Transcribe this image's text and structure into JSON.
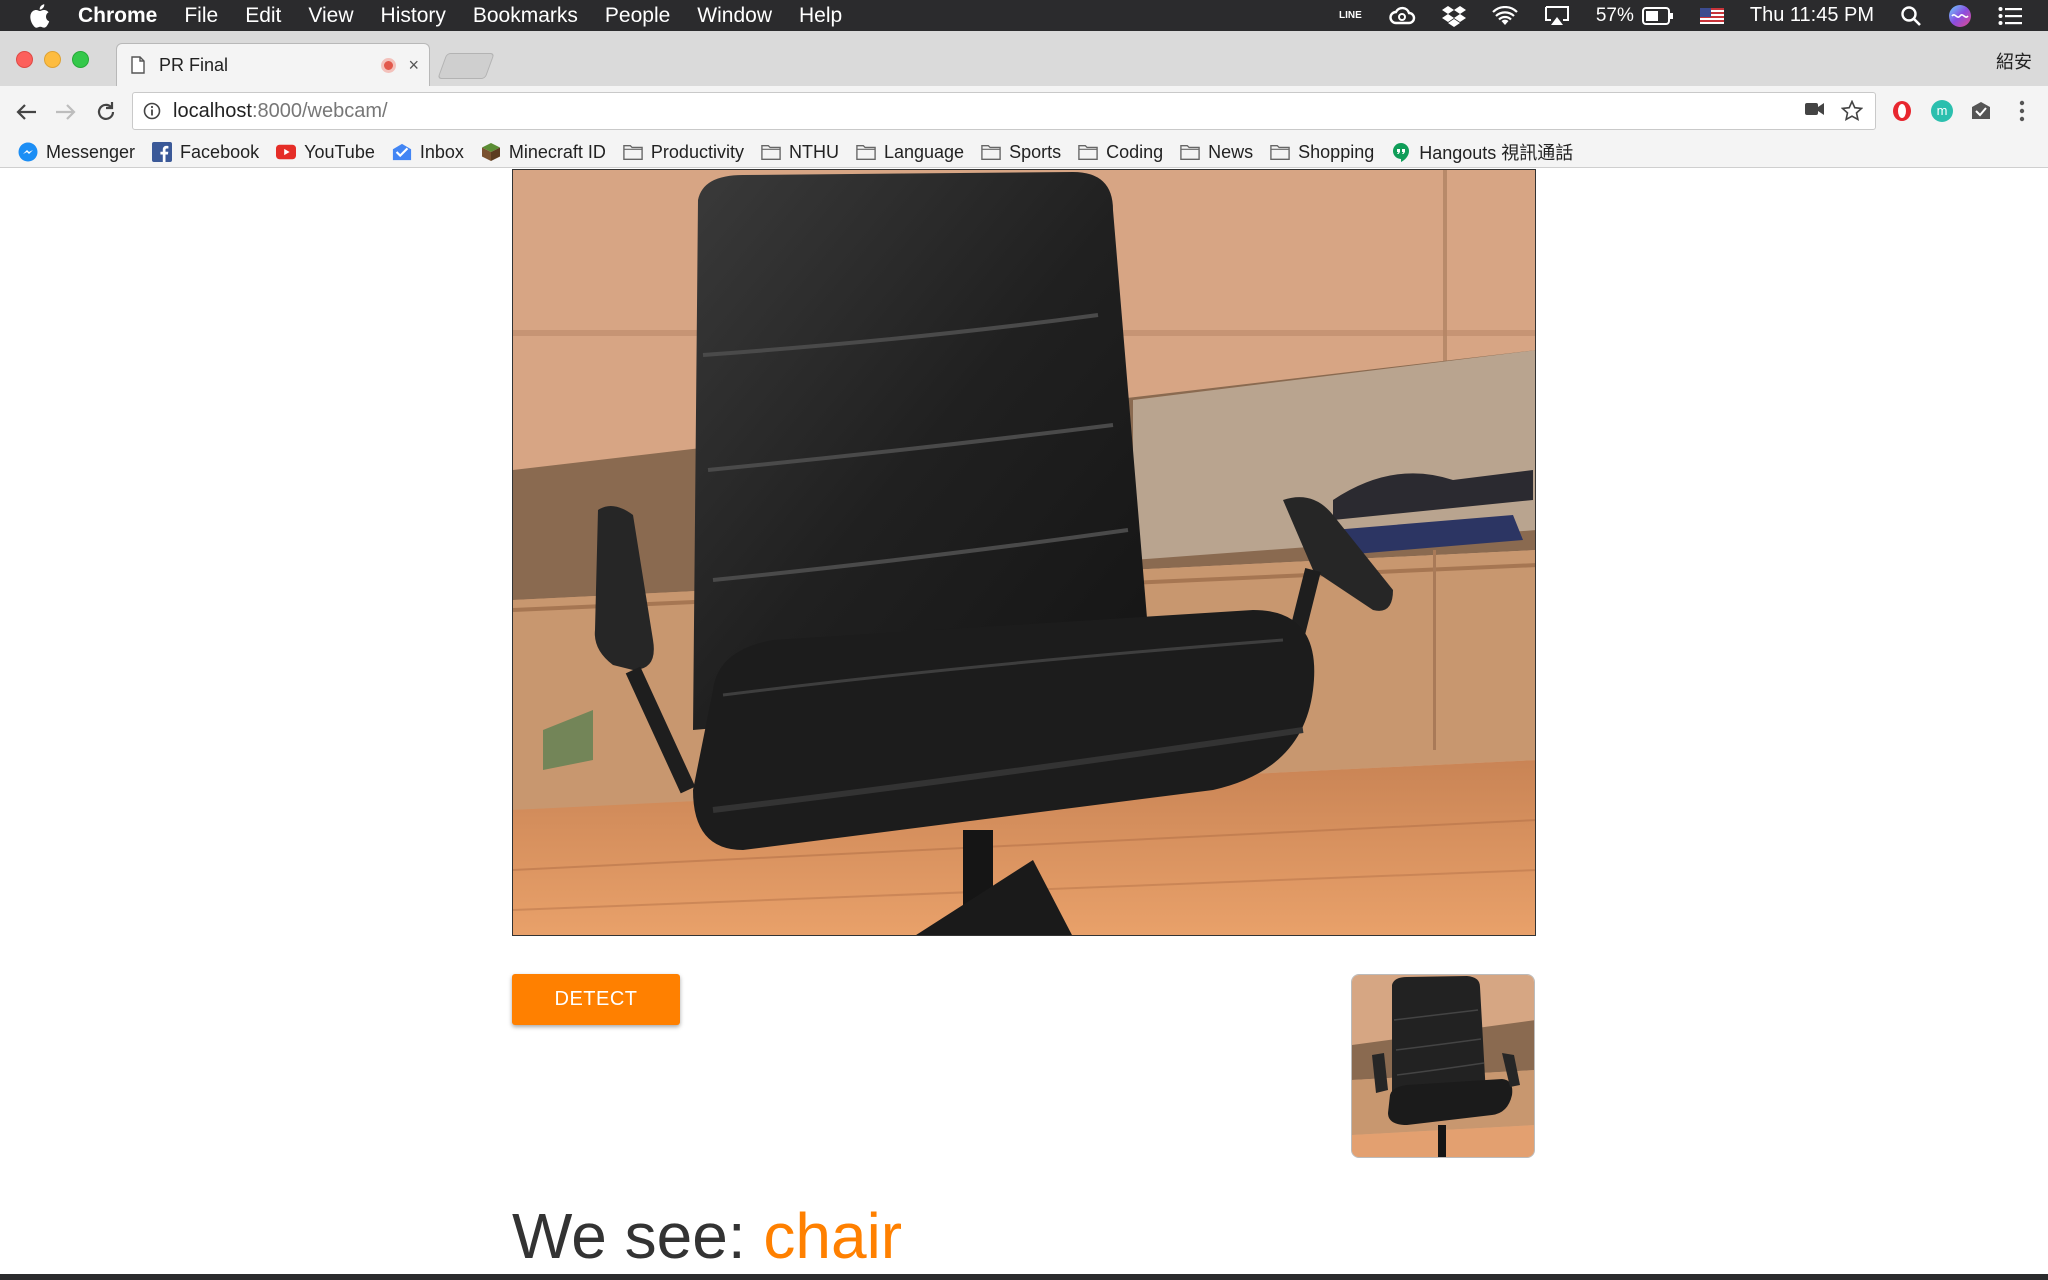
{
  "menubar": {
    "app": "Chrome",
    "items": [
      "File",
      "Edit",
      "View",
      "History",
      "Bookmarks",
      "People",
      "Window",
      "Help"
    ],
    "battery": "57%",
    "clock": "Thu 11:45 PM",
    "line_label": "LINE"
  },
  "tab": {
    "title": "PR Final",
    "close": "×"
  },
  "window": {
    "profile": "紹安"
  },
  "toolbar": {
    "url_host": "localhost",
    "url_rest": ":8000/webcam/"
  },
  "bookmarks": [
    {
      "label": "Messenger",
      "icon": "messenger-icon"
    },
    {
      "label": "Facebook",
      "icon": "facebook-icon"
    },
    {
      "label": "YouTube",
      "icon": "youtube-icon"
    },
    {
      "label": "Inbox",
      "icon": "inbox-icon"
    },
    {
      "label": "Minecraft ID",
      "icon": "minecraft-icon"
    },
    {
      "label": "Productivity",
      "icon": "folder-icon"
    },
    {
      "label": "NTHU",
      "icon": "folder-icon"
    },
    {
      "label": "Language",
      "icon": "folder-icon"
    },
    {
      "label": "Sports",
      "icon": "folder-icon"
    },
    {
      "label": "Coding",
      "icon": "folder-icon"
    },
    {
      "label": "News",
      "icon": "folder-icon"
    },
    {
      "label": "Shopping",
      "icon": "folder-icon"
    },
    {
      "label": "Hangouts 視訊通話",
      "icon": "hangouts-icon"
    }
  ],
  "main": {
    "detect_label": "DETECT",
    "result_prefix": "We see: ",
    "result_label": "chair"
  },
  "colors": {
    "accent": "#ff8000",
    "menubar": "#2b2b2d"
  }
}
